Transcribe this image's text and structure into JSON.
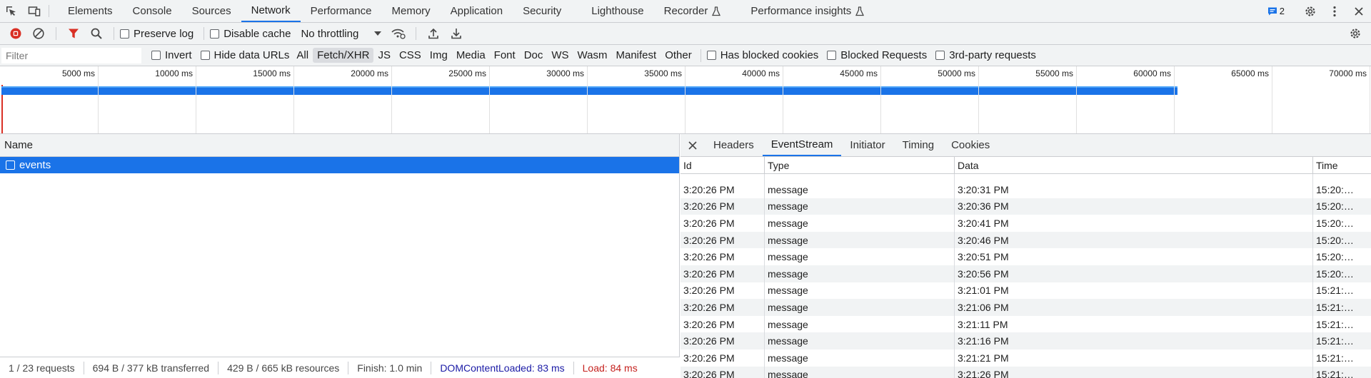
{
  "main_tabs": [
    {
      "label": "Elements"
    },
    {
      "label": "Console"
    },
    {
      "label": "Sources"
    },
    {
      "label": "Network",
      "active": true
    },
    {
      "label": "Performance"
    },
    {
      "label": "Memory"
    },
    {
      "label": "Application"
    },
    {
      "label": "Security"
    },
    {
      "label": "Lighthouse"
    },
    {
      "label": "Recorder",
      "experimental": true
    },
    {
      "label": "Performance insights",
      "experimental": true
    }
  ],
  "issues_count": "2",
  "toolbar": {
    "preserve_log": "Preserve log",
    "disable_cache": "Disable cache",
    "throttling": "No throttling"
  },
  "filter": {
    "placeholder": "Filter",
    "invert": "Invert",
    "hide_data_urls": "Hide data URLs",
    "types": [
      "All",
      "Fetch/XHR",
      "JS",
      "CSS",
      "Img",
      "Media",
      "Font",
      "Doc",
      "WS",
      "Wasm",
      "Manifest",
      "Other"
    ],
    "active_type": "Fetch/XHR",
    "has_blocked_cookies": "Has blocked cookies",
    "blocked_requests": "Blocked Requests",
    "third_party": "3rd-party requests"
  },
  "overview": {
    "ticks": [
      "5000 ms",
      "10000 ms",
      "15000 ms",
      "20000 ms",
      "25000 ms",
      "30000 ms",
      "35000 ms",
      "40000 ms",
      "45000 ms",
      "50000 ms",
      "55000 ms",
      "60000 ms",
      "65000 ms",
      "70000 ms"
    ],
    "bar_end_ms": 60200
  },
  "requests": {
    "header": "Name",
    "rows": [
      {
        "name": "events",
        "selected": true
      }
    ]
  },
  "status": {
    "requests": "1 / 23 requests",
    "transferred": "694 B / 377 kB transferred",
    "resources": "429 B / 665 kB resources",
    "finish": "Finish: 1.0 min",
    "dcl": "DOMContentLoaded: 83 ms",
    "load": "Load: 84 ms"
  },
  "detail": {
    "tabs": [
      {
        "label": "Headers"
      },
      {
        "label": "EventStream",
        "active": true
      },
      {
        "label": "Initiator"
      },
      {
        "label": "Timing"
      },
      {
        "label": "Cookies"
      }
    ],
    "columns": {
      "id": "Id",
      "type": "Type",
      "data": "Data",
      "time": "Time"
    },
    "rows": [
      {
        "id": "3:20:26 PM",
        "type": "message",
        "data": "3:20:31 PM",
        "time": "15:20:…"
      },
      {
        "id": "3:20:26 PM",
        "type": "message",
        "data": "3:20:36 PM",
        "time": "15:20:…"
      },
      {
        "id": "3:20:26 PM",
        "type": "message",
        "data": "3:20:41 PM",
        "time": "15:20:…"
      },
      {
        "id": "3:20:26 PM",
        "type": "message",
        "data": "3:20:46 PM",
        "time": "15:20:…"
      },
      {
        "id": "3:20:26 PM",
        "type": "message",
        "data": "3:20:51 PM",
        "time": "15:20:…"
      },
      {
        "id": "3:20:26 PM",
        "type": "message",
        "data": "3:20:56 PM",
        "time": "15:20:…"
      },
      {
        "id": "3:20:26 PM",
        "type": "message",
        "data": "3:21:01 PM",
        "time": "15:21:…"
      },
      {
        "id": "3:20:26 PM",
        "type": "message",
        "data": "3:21:06 PM",
        "time": "15:21:…"
      },
      {
        "id": "3:20:26 PM",
        "type": "message",
        "data": "3:21:11 PM",
        "time": "15:21:…"
      },
      {
        "id": "3:20:26 PM",
        "type": "message",
        "data": "3:21:16 PM",
        "time": "15:21:…"
      },
      {
        "id": "3:20:26 PM",
        "type": "message",
        "data": "3:21:21 PM",
        "time": "15:21:…"
      },
      {
        "id": "3:20:26 PM",
        "type": "message",
        "data": "3:21:26 PM",
        "time": "15:21:…"
      }
    ]
  },
  "colors": {
    "accent": "#1a73e8",
    "record": "#d93025",
    "filter_active": "#d93025",
    "dcl": "#1a1aa6",
    "load": "#c5221f"
  }
}
